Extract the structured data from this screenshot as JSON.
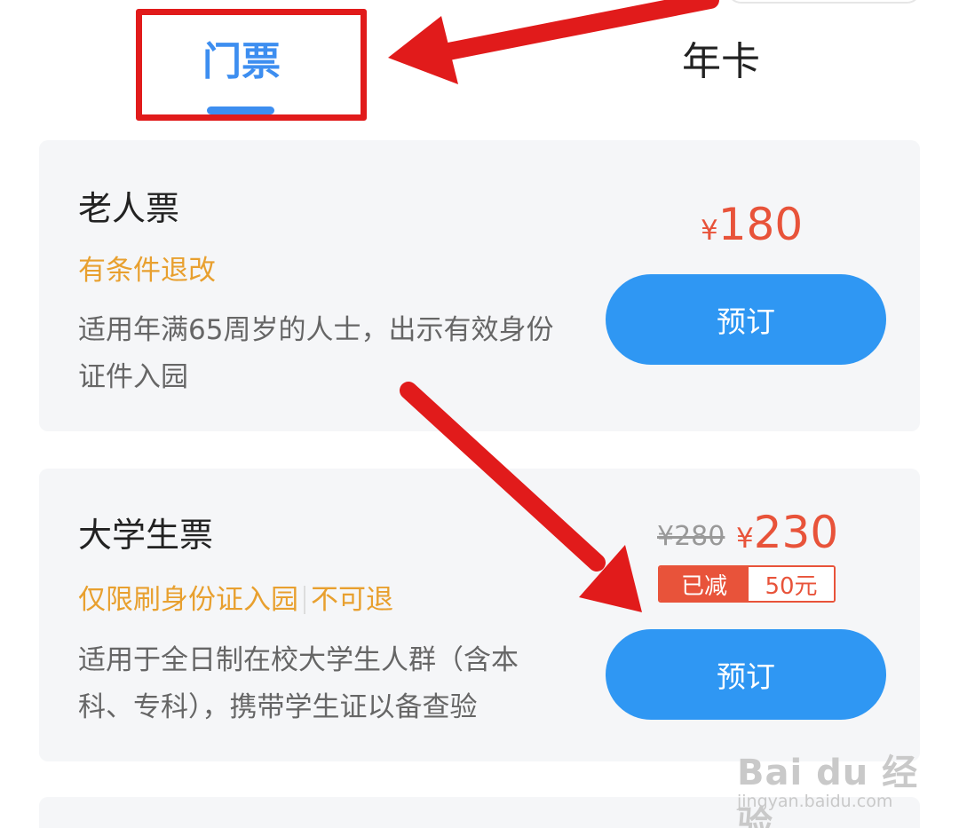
{
  "tabs": [
    {
      "label": "门票",
      "active": true
    },
    {
      "label": "年卡",
      "active": false
    }
  ],
  "tickets": [
    {
      "name": "老人票",
      "policy": [
        "有条件退改"
      ],
      "description": "适用年满65周岁的人士，出示有效身份证件入园",
      "currency": "¥",
      "price": "180",
      "button": "预订"
    },
    {
      "name": "大学生票",
      "policy": [
        "仅限刷身份证入园",
        "不可退"
      ],
      "description": "适用于全日制在校大学生人群（含本科、专科），携带学生证以备查验",
      "original_price": "¥280",
      "currency": "¥",
      "price": "230",
      "discount_label": "已减",
      "discount_value": "50元",
      "button": "预订"
    }
  ],
  "watermark": {
    "logo": "Bai du 经验",
    "url": "jingyan.baidu.com"
  },
  "colors": {
    "accent": "#3d8ef0",
    "button": "#2f97f3",
    "price": "#e8533a",
    "policy": "#e8a02f",
    "annotation": "#e11b1b",
    "card_bg": "#f5f6f8"
  }
}
